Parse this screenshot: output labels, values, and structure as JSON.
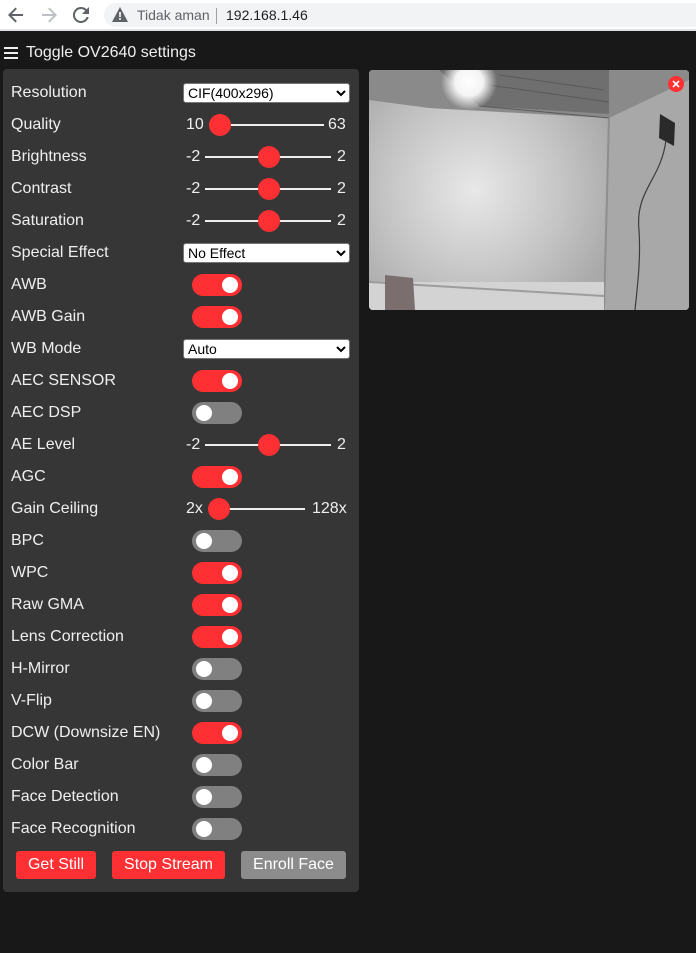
{
  "browser": {
    "security_label": "Tidak aman",
    "url": "192.168.1.46"
  },
  "header": {
    "toggle_label": "Toggle OV2640 settings"
  },
  "settings": {
    "resolution": {
      "label": "Resolution",
      "value": "CIF(400x296)"
    },
    "quality": {
      "label": "Quality",
      "min": "10",
      "max": "63",
      "value": 10
    },
    "brightness": {
      "label": "Brightness",
      "min": "-2",
      "max": "2",
      "value": 0
    },
    "contrast": {
      "label": "Contrast",
      "min": "-2",
      "max": "2",
      "value": 0
    },
    "saturation": {
      "label": "Saturation",
      "min": "-2",
      "max": "2",
      "value": 0
    },
    "special_effect": {
      "label": "Special Effect",
      "value": "No Effect"
    },
    "awb": {
      "label": "AWB",
      "on": true
    },
    "awb_gain": {
      "label": "AWB Gain",
      "on": true
    },
    "wb_mode": {
      "label": "WB Mode",
      "value": "Auto"
    },
    "aec_sensor": {
      "label": "AEC SENSOR",
      "on": true
    },
    "aec_dsp": {
      "label": "AEC DSP",
      "on": false
    },
    "ae_level": {
      "label": "AE Level",
      "min": "-2",
      "max": "2",
      "value": 0
    },
    "agc": {
      "label": "AGC",
      "on": true
    },
    "gain_ceiling": {
      "label": "Gain Ceiling",
      "min": "2x",
      "max": "128x",
      "value": 0
    },
    "bpc": {
      "label": "BPC",
      "on": false
    },
    "wpc": {
      "label": "WPC",
      "on": true
    },
    "raw_gma": {
      "label": "Raw GMA",
      "on": true
    },
    "lens_correction": {
      "label": "Lens Correction",
      "on": true
    },
    "h_mirror": {
      "label": "H-Mirror",
      "on": false
    },
    "v_flip": {
      "label": "V-Flip",
      "on": false
    },
    "dcw": {
      "label": "DCW (Downsize EN)",
      "on": true
    },
    "color_bar": {
      "label": "Color Bar",
      "on": false
    },
    "face_detection": {
      "label": "Face Detection",
      "on": false
    },
    "face_recognition": {
      "label": "Face Recognition",
      "on": false
    }
  },
  "buttons": {
    "get_still": "Get Still",
    "stop_stream": "Stop Stream",
    "enroll_face": "Enroll Face"
  },
  "colors": {
    "accent": "#ff3034",
    "panel": "#363636",
    "background": "#181818",
    "switch_off": "#808080",
    "button_disabled": "#8c8c8c"
  }
}
